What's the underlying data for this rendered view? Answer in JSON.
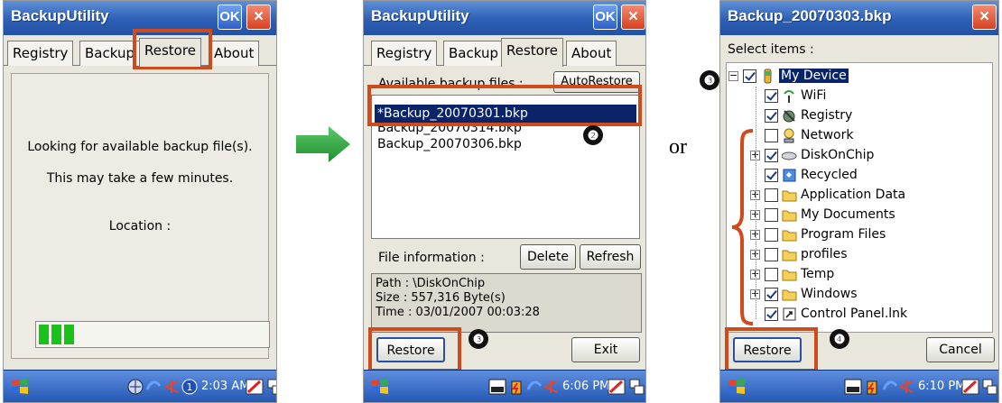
{
  "screen1": {
    "title": "BackupUtility",
    "ok_label": "OK",
    "close_label": "×",
    "tabs": [
      "Registry",
      "Backup",
      "Restore",
      "About"
    ],
    "active_tab": "Restore",
    "message1": "Looking for available backup file(s).",
    "message2": "This may take a few minutes.",
    "location_label": "Location :",
    "progress_fraction": 0.18,
    "step_marker": "❶",
    "time": "2:03 AM"
  },
  "screen2": {
    "title": "BackupUtility",
    "ok_label": "OK",
    "close_label": "×",
    "tabs": [
      "Registry",
      "Backup",
      "Restore",
      "About"
    ],
    "active_tab": "Restore",
    "available_label": "Available backup files :",
    "autorestore_label": "AutoRestore",
    "files": [
      "*Backup_20070301.bkp",
      "Backup_20070314.bkp",
      "Backup_20070306.bkp"
    ],
    "selected_index": 0,
    "file_info_label": "File information :",
    "delete_label": "Delete",
    "refresh_label": "Refresh",
    "info_path": "Path : \\DiskOnChip",
    "info_size": "Size : 557,316 Byte(s)",
    "info_time": "Time : 03/01/2007 00:03:28",
    "restore_label": "Restore",
    "exit_label": "Exit",
    "step_marker_a": "❷",
    "step_marker_b": "❸",
    "time": "6:06 PM"
  },
  "screen3": {
    "title": "Backup_20070303.bkp",
    "close_label": "×",
    "select_label": "Select items :",
    "tree": [
      {
        "label": "My Device",
        "checked": true,
        "expander": "−",
        "level": 0,
        "icon": "device-icon",
        "highlight": true
      },
      {
        "label": "WiFi",
        "checked": true,
        "expander": "",
        "level": 1,
        "icon": "wifi-icon",
        "highlight": false
      },
      {
        "label": "Registry",
        "checked": true,
        "expander": "",
        "level": 1,
        "icon": "registry-icon",
        "highlight": false
      },
      {
        "label": "Network",
        "checked": false,
        "expander": "",
        "level": 1,
        "icon": "network-icon",
        "highlight": false
      },
      {
        "label": "DiskOnChip",
        "checked": true,
        "expander": "+",
        "level": 1,
        "icon": "disk-icon",
        "highlight": false
      },
      {
        "label": "Recycled",
        "checked": true,
        "expander": "",
        "level": 1,
        "icon": "recycled-icon",
        "highlight": false
      },
      {
        "label": "Application Data",
        "checked": false,
        "expander": "+",
        "level": 1,
        "icon": "folder-icon",
        "highlight": false
      },
      {
        "label": "My Documents",
        "checked": false,
        "expander": "+",
        "level": 1,
        "icon": "folder-icon",
        "highlight": false
      },
      {
        "label": "Program Files",
        "checked": false,
        "expander": "+",
        "level": 1,
        "icon": "folder-icon",
        "highlight": false
      },
      {
        "label": "profiles",
        "checked": false,
        "expander": "+",
        "level": 1,
        "icon": "folder-icon",
        "highlight": false
      },
      {
        "label": "Temp",
        "checked": false,
        "expander": "+",
        "level": 1,
        "icon": "folder-icon",
        "highlight": false
      },
      {
        "label": "Windows",
        "checked": true,
        "expander": "+",
        "level": 1,
        "icon": "folder-icon",
        "highlight": false
      },
      {
        "label": "Control Panel.lnk",
        "checked": true,
        "expander": "",
        "level": 1,
        "icon": "shortcut-icon",
        "highlight": false
      }
    ],
    "restore_label": "Restore",
    "cancel_label": "Cancel",
    "step_marker_a": "❸",
    "step_marker_b": "❹",
    "time": "6:10 PM"
  },
  "or_text": "or",
  "colors": {
    "title_blue": "#2c60b6",
    "highlight_red": "#cf4a1c",
    "arrow_green": "#2fa640",
    "selection_navy": "#0a246a"
  }
}
